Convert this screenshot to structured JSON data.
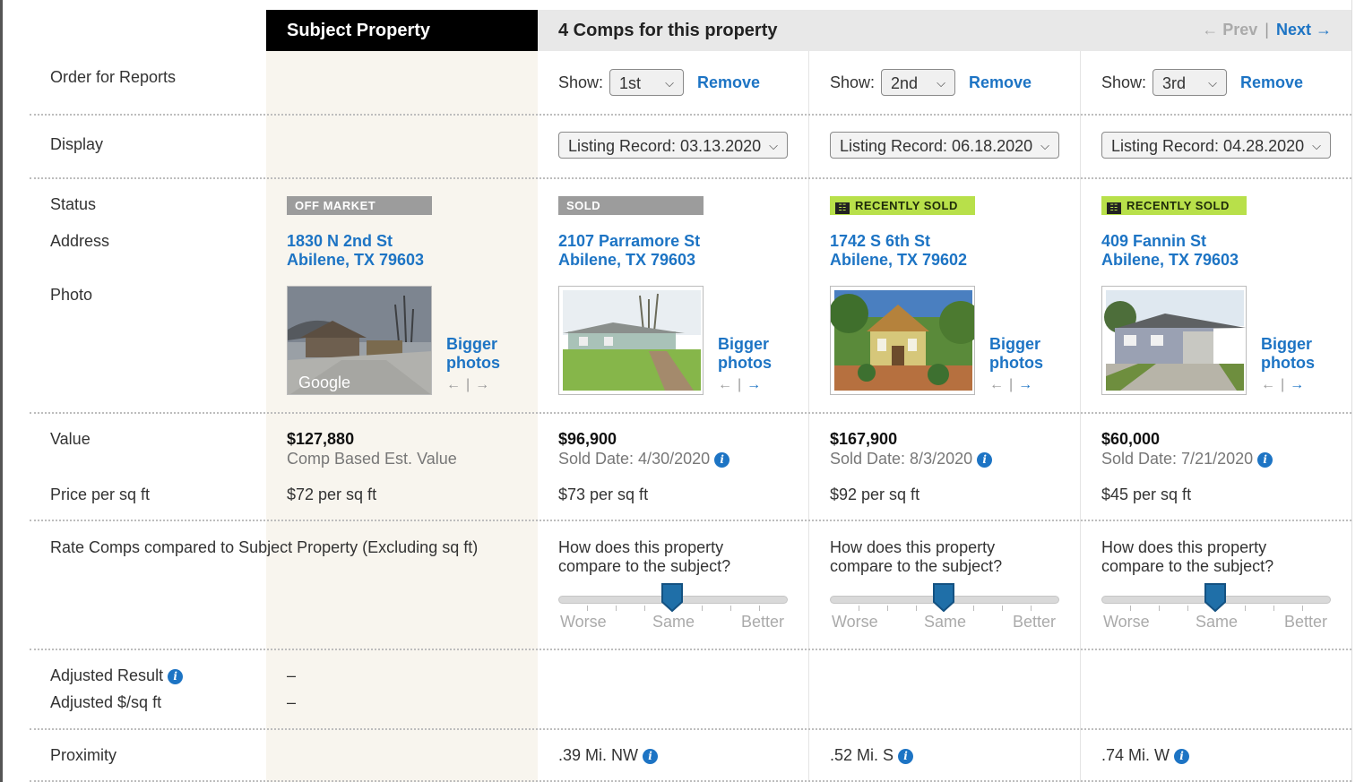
{
  "header": {
    "subject_title": "Subject Property",
    "comps_title": "4 Comps for this property",
    "prev": "← Prev",
    "sep": "|",
    "next": "Next →"
  },
  "labels": {
    "order": "Order for Reports",
    "display": "Display",
    "status": "Status",
    "address": "Address",
    "photo": "Photo",
    "value": "Value",
    "ppsf": "Price per sq ft",
    "rate": "Rate Comps compared to Subject Property (Excluding sq ft)",
    "adj_result": "Adjusted Result",
    "adj_ppsf": "Adjusted $/sq ft",
    "proximity": "Proximity"
  },
  "subject": {
    "status": "OFF MARKET",
    "street": "1830 N 2nd St",
    "city": "Abilene, TX 79603",
    "photo_brand": "Google",
    "bigger1": "Bigger",
    "bigger2": "photos",
    "value": "$127,880",
    "value_note": "Comp Based Est. Value",
    "ppsf": "$72 per sq ft",
    "adj_result": "–",
    "adj_ppsf": "–"
  },
  "common": {
    "show": "Show:",
    "remove": "Remove",
    "question1": "How does this property",
    "question2": "compare to the subject?",
    "worse": "Worse",
    "same": "Same",
    "better": "Better",
    "bigger1": "Bigger",
    "bigger2": "photos",
    "arrow_left": "←",
    "arrow_right": "→",
    "arrow_sep": "|",
    "info": "i"
  },
  "comps": [
    {
      "order": "1st",
      "display": "Listing Record: 03.13.2020",
      "status": "SOLD",
      "street": "2107 Parramore St",
      "city": "Abilene, TX 79603",
      "value": "$96,900",
      "sold_date": "Sold Date: 4/30/2020",
      "ppsf": "$73 per sq ft",
      "rating": "Same",
      "proximity": ".39 Mi. NW"
    },
    {
      "order": "2nd",
      "display": "Listing Record: 06.18.2020",
      "status": "RECENTLY SOLD",
      "street": "1742 S 6th St",
      "city": "Abilene, TX 79602",
      "value": "$167,900",
      "sold_date": "Sold Date: 8/3/2020",
      "ppsf": "$92 per sq ft",
      "rating": "Same",
      "proximity": ".52 Mi. S"
    },
    {
      "order": "3rd",
      "display": "Listing Record: 04.28.2020",
      "status": "RECENTLY SOLD",
      "street": "409 Fannin St",
      "city": "Abilene, TX 79603",
      "value": "$60,000",
      "sold_date": "Sold Date: 7/21/2020",
      "ppsf": "$45 per sq ft",
      "rating": "Same",
      "proximity": ".74 Mi. W"
    }
  ],
  "colors": {
    "link": "#1d74c4",
    "status_gray": "#9c9c9c",
    "status_green": "#b8e04a",
    "subject_bg": "#f8f5ee",
    "header_black": "#000000"
  }
}
